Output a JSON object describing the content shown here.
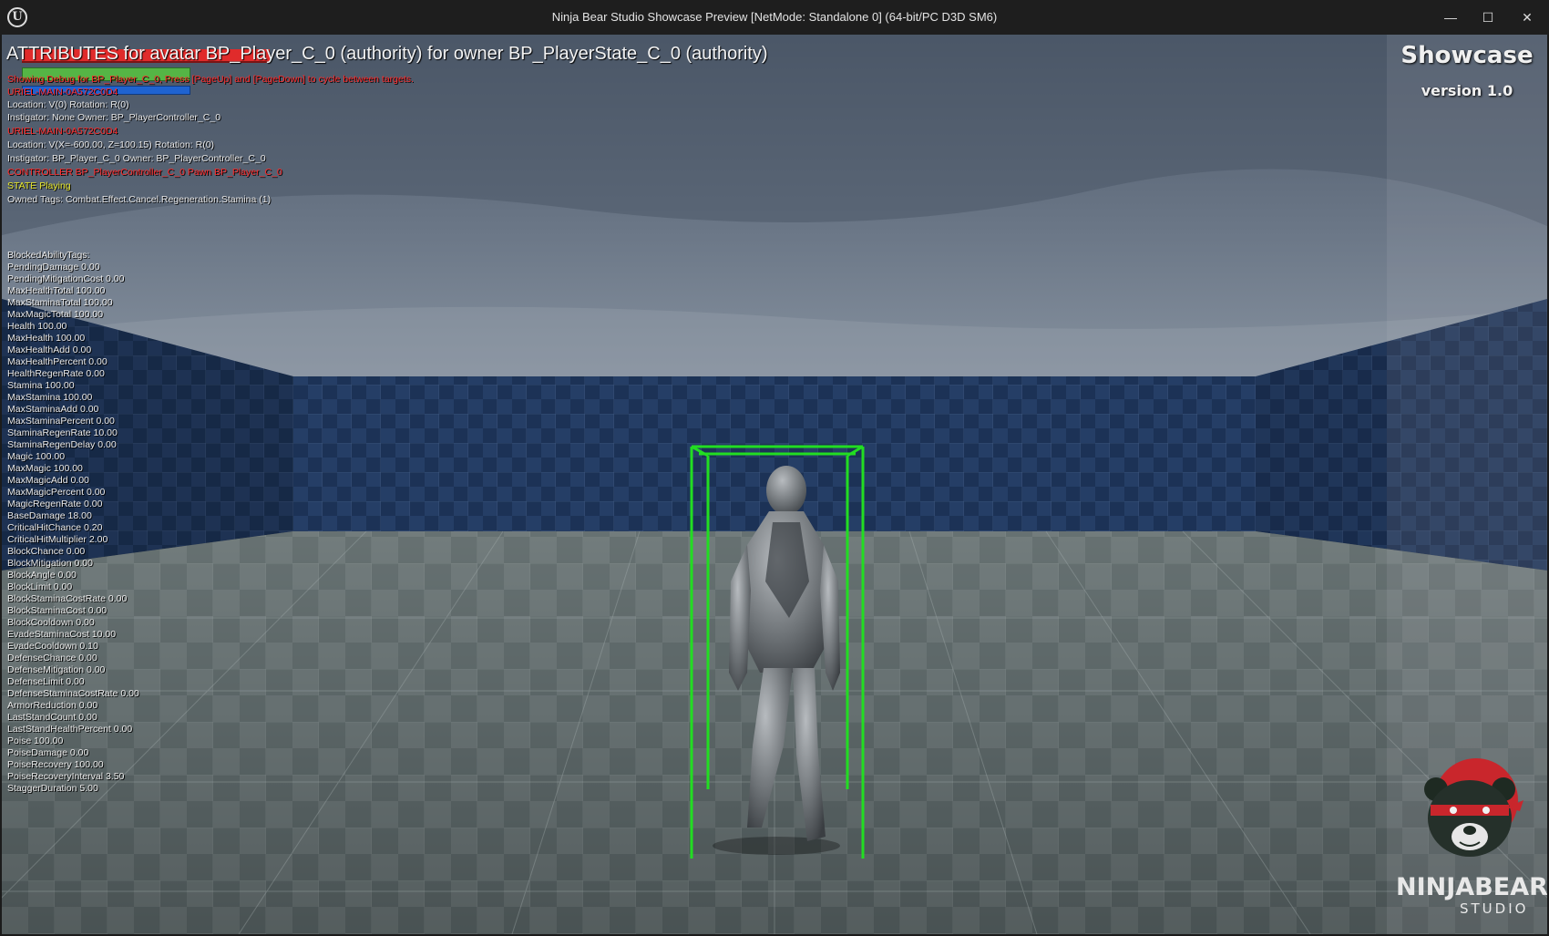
{
  "window": {
    "title": "Ninja Bear Studio Showcase Preview [NetMode: Standalone 0]  (64-bit/PC D3D SM6)",
    "minimize_glyph": "—",
    "maximize_glyph": "☐",
    "close_glyph": "✕",
    "app_icon_glyph": "U"
  },
  "hud": {
    "header": "ATTRIBUTES for avatar BP_Player_C_0 (authority) for owner BP_PlayerState_C_0 (authority)",
    "health_fill": 1.0,
    "stamina_fill": 1.0,
    "magic_fill": 1.0,
    "debug_lines": {
      "showing_debug": "Showing Debug for BP_Player_C_0, Press [PageUp] and [PageDown] to cycle between targets.",
      "uriel_1": "URIEL-MAIN-0A572C0D4",
      "location_1": "Location: V(0) Rotation: R(0)",
      "instigator_1": " Instigator: None Owner: BP_PlayerController_C_0",
      "uriel_2": "URIEL-MAIN-0A572C0D4",
      "location_2": "Location: V(X=-600.00, Z=100.15) Rotation: R(0)",
      "instigator_2": " Instigator: BP_Player_C_0 Owner: BP_PlayerController_C_0",
      "controller": "CONTROLLER BP_PlayerController_C_0 Pawn BP_Player_C_0",
      "state": "STATE Playing",
      "owned_tags": "Owned Tags: Combat.Effect.Cancel.Regeneration.Stamina (1)"
    },
    "attributes": [
      "BlockedAbilityTags:",
      "PendingDamage 0.00",
      "PendingMitigationCost 0.00",
      "MaxHealthTotal 100.00",
      "MaxStaminaTotal 100.00",
      "MaxMagicTotal 100.00",
      "Health 100.00",
      "MaxHealth 100.00",
      "MaxHealthAdd 0.00",
      "MaxHealthPercent 0.00",
      "HealthRegenRate 0.00",
      "Stamina 100.00",
      "MaxStamina 100.00",
      "MaxStaminaAdd 0.00",
      "MaxStaminaPercent 0.00",
      "StaminaRegenRate 10.00",
      "StaminaRegenDelay 0.00",
      "Magic 100.00",
      "MaxMagic 100.00",
      "MaxMagicAdd 0.00",
      "MaxMagicPercent 0.00",
      "MagicRegenRate 0.00",
      "BaseDamage 18.00",
      "CriticalHitChance 0.20",
      "CriticalHitMultiplier 2.00",
      "BlockChance 0.00",
      "BlockMitigation 0.00",
      "BlockAngle 0.00",
      "BlockLimit 0.00",
      "BlockStaminaCostRate 0.00",
      "BlockStaminaCost 0.00",
      "BlockCooldown 0.00",
      "EvadeStaminaCost 10.00",
      "EvadeCooldown 0.10",
      "DefenseChance 0.00",
      "DefenseMitigation 0.00",
      "DefenseLimit 0.00",
      "DefenseStaminaCostRate 0.00",
      "ArmorReduction 0.00",
      "LastStandCount 0.00",
      "LastStandHealthPercent 0.00",
      "Poise 100.00",
      "PoiseDamage 0.00",
      "PoiseRecovery 100.00",
      "PoiseRecoveryInterval 3.50",
      "StaggerDuration 5.00"
    ]
  },
  "branding": {
    "title": "Showcase",
    "version": "version 1.0",
    "logo_word": "NINJABEAR",
    "logo_sub": "STUDIO"
  },
  "colors": {
    "debug_box": "#22dd22",
    "health": "#e02b2b",
    "stamina": "#55b545",
    "magic": "#1f63d0",
    "logo_red": "#c9262c"
  }
}
